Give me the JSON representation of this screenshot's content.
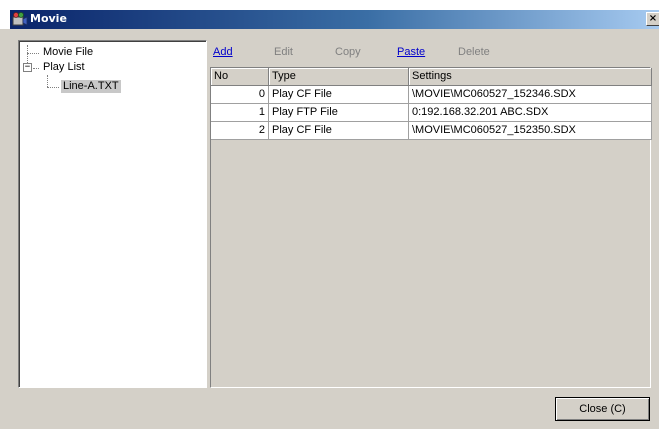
{
  "window": {
    "title": "Movie",
    "close_glyph": "×"
  },
  "tree": {
    "items": [
      {
        "label": "Movie File"
      },
      {
        "label": "Play List",
        "expander": "−"
      },
      {
        "label": "Line-A.TXT"
      }
    ]
  },
  "toolbar": {
    "add": "Add",
    "edit": "Edit",
    "copy": "Copy",
    "paste": "Paste",
    "delete": "Delete"
  },
  "grid": {
    "columns": [
      "No",
      "Type",
      "Settings"
    ],
    "rows": [
      [
        "0",
        "Play CF File",
        "\\MOVIE\\MC060527_152346.SDX"
      ],
      [
        "1",
        "Play FTP File",
        "0:192.168.32.201  ABC.SDX"
      ],
      [
        "2",
        "Play CF File",
        "\\MOVIE\\MC060527_152350.SDX"
      ]
    ]
  },
  "buttons": {
    "close": "Close (C)"
  },
  "colors": {
    "title_start": "#0a246a",
    "title_end": "#a6caf0",
    "face": "#d4d0c8",
    "link": "#0000cc"
  }
}
